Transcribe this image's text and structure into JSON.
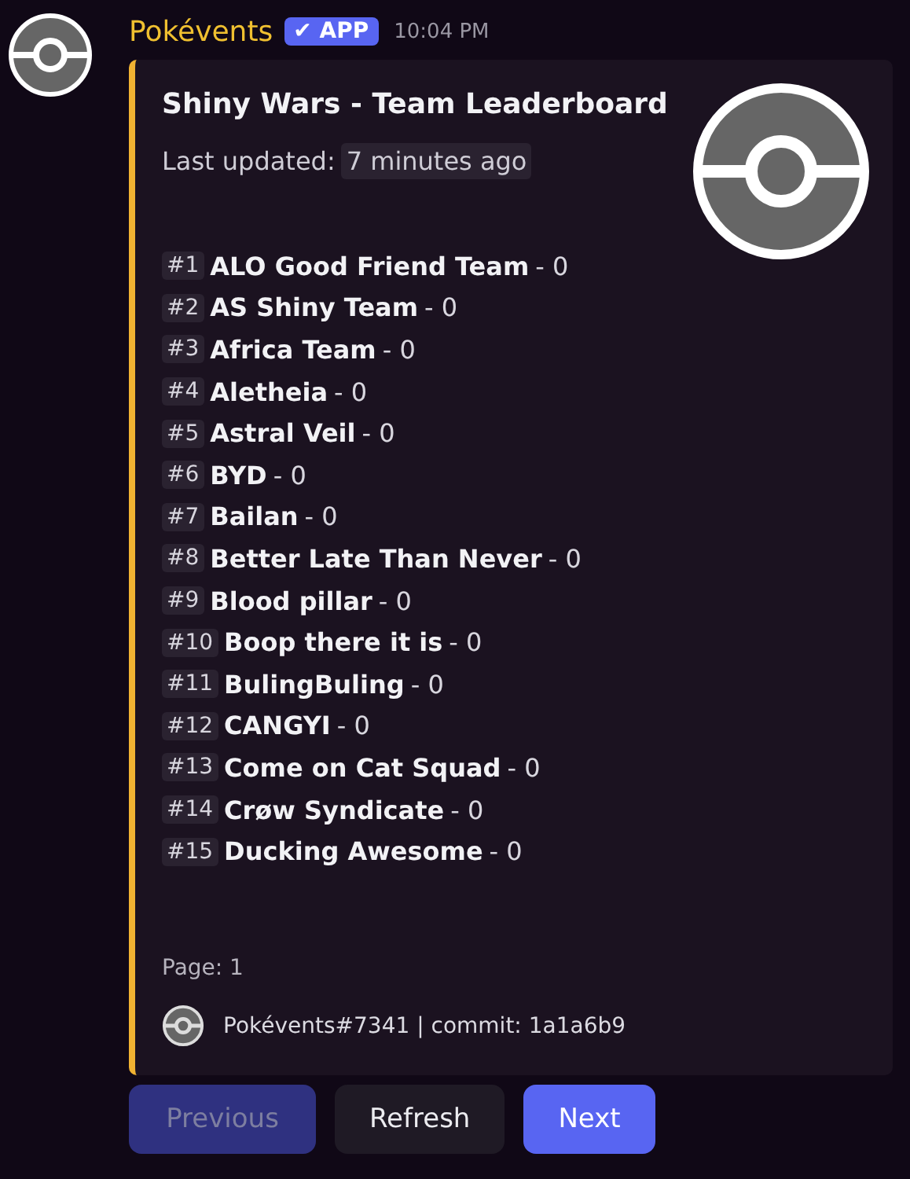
{
  "message": {
    "author": "Pokévents",
    "badge": {
      "check": "✔",
      "label": "APP"
    },
    "time": "10:04 PM"
  },
  "embed": {
    "title": "Shiny Wars - Team Leaderboard",
    "updated_label": "Last updated:",
    "updated_value": "7 minutes ago",
    "rows": [
      {
        "rank": "#1",
        "team": "ALO Good Friend Team",
        "score": "- 0"
      },
      {
        "rank": "#2",
        "team": "AS Shiny Team",
        "score": "- 0"
      },
      {
        "rank": "#3",
        "team": "Africa Team",
        "score": "- 0"
      },
      {
        "rank": "#4",
        "team": "Aletheia",
        "score": "- 0"
      },
      {
        "rank": "#5",
        "team": "Astral Veil",
        "score": "- 0"
      },
      {
        "rank": "#6",
        "team": "BYD",
        "score": "- 0"
      },
      {
        "rank": "#7",
        "team": "Bailan",
        "score": "- 0"
      },
      {
        "rank": "#8",
        "team": "Better Late Than Never",
        "score": "- 0"
      },
      {
        "rank": "#9",
        "team": "Blood pillar",
        "score": "- 0"
      },
      {
        "rank": "#10",
        "team": "Boop there it is",
        "score": "- 0"
      },
      {
        "rank": "#11",
        "team": "BulingBuling",
        "score": "- 0"
      },
      {
        "rank": "#12",
        "team": "CANGYI",
        "score": "- 0"
      },
      {
        "rank": "#13",
        "team": "Come on Cat Squad",
        "score": "- 0"
      },
      {
        "rank": "#14",
        "team": "Crøw Syndicate",
        "score": "- 0"
      },
      {
        "rank": "#15",
        "team": "Ducking Awesome",
        "score": "- 0"
      }
    ],
    "page": "Page: 1",
    "footer": "Pokévents#7341 | commit: 1a1a6b9"
  },
  "buttons": [
    {
      "label": "Previous",
      "kind": "primary",
      "disabled": true
    },
    {
      "label": "Refresh",
      "kind": "secondary",
      "disabled": false
    },
    {
      "label": "Next",
      "kind": "primary",
      "disabled": false
    }
  ]
}
